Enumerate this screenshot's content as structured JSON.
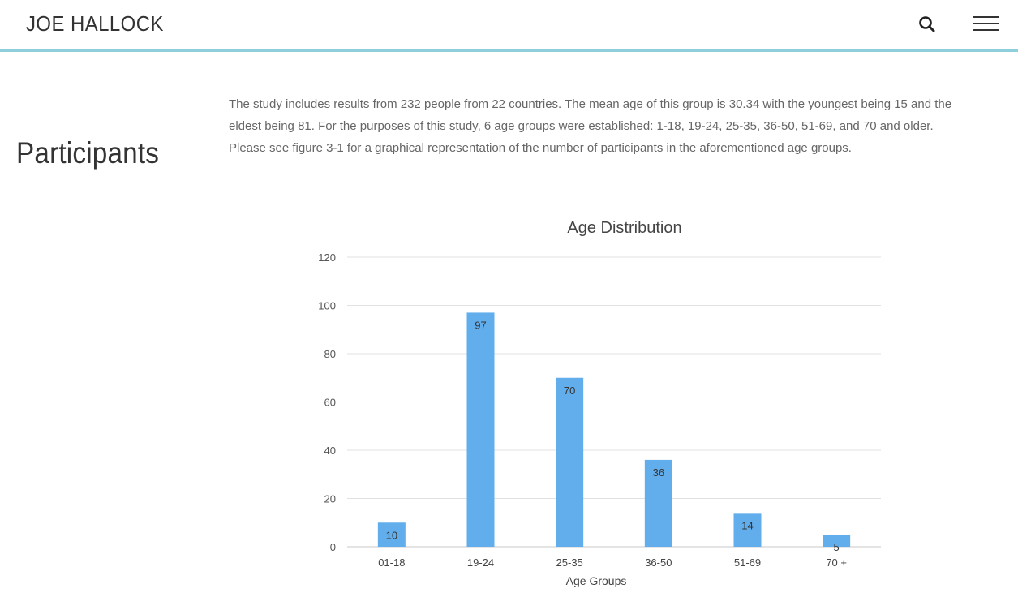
{
  "header": {
    "brand": "JOE HALLOCK",
    "search_icon": "search-icon",
    "menu_icon": "hamburger-menu-icon"
  },
  "section": {
    "title": "Participants",
    "intro": "The study includes results from 232 people from 22 countries. The mean age of this group is 30.34 with the youngest being 15 and the eldest being 81. For the purposes of this study, 6 age groups were established: 1-18, 19-24, 25-35, 36-50, 51-69, and 70 and older. Please see figure 3-1 for a graphical representation of the number of participants in the aforementioned age groups."
  },
  "colors": {
    "accent_line": "#8fcfdc",
    "bar": "#62aeec"
  },
  "chart_data": {
    "type": "bar",
    "title": "Age Distribution",
    "xlabel": "Age Groups",
    "ylabel": "",
    "categories": [
      "01-18",
      "19-24",
      "25-35",
      "36-50",
      "51-69",
      "70 +"
    ],
    "values": [
      10,
      97,
      70,
      36,
      14,
      5
    ],
    "ylim": [
      0,
      120
    ],
    "yticks": [
      0,
      20,
      40,
      60,
      80,
      100,
      120
    ],
    "grid": true,
    "legend": "none",
    "data_labels": true
  }
}
